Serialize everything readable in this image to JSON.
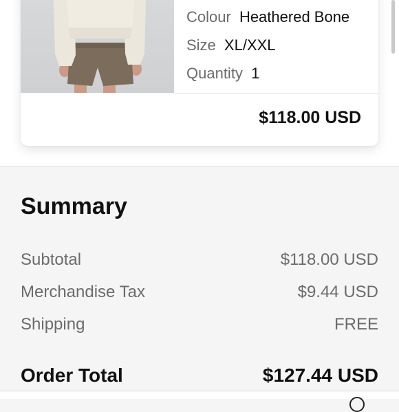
{
  "product": {
    "attributes": [
      {
        "label": "Colour",
        "value": "Heathered Bone"
      },
      {
        "label": "Size",
        "value": "XL/XXL"
      },
      {
        "label": "Quantity",
        "value": "1"
      }
    ],
    "price": "$118.00 USD"
  },
  "summary": {
    "title": "Summary",
    "rows": [
      {
        "label": "Subtotal",
        "value": "$118.00 USD"
      },
      {
        "label": "Merchandise Tax",
        "value": "$9.44 USD"
      },
      {
        "label": "Shipping",
        "value": "FREE"
      }
    ],
    "total": {
      "label": "Order Total",
      "value": "$127.44 USD"
    }
  }
}
